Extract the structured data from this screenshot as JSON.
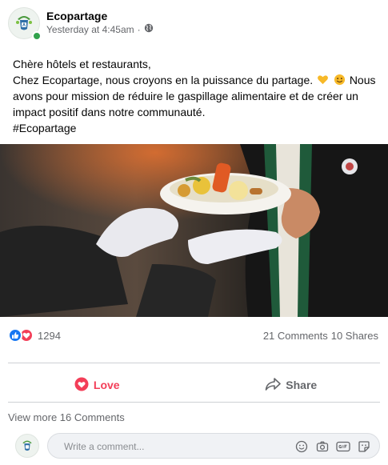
{
  "post": {
    "page_name": "Ecopartage",
    "timestamp": "Yesterday at 4:45am",
    "separator": "·",
    "privacy_icon": "globe-icon",
    "text_lines": {
      "l1": "Chère hôtels et restaurants,",
      "l2": "Chez Ecopartage, nous croyons en la puissance du partage.",
      "l2b": "Nous",
      "l3": "avons pour mission de réduire le gaspillage alimentaire et de créer un",
      "l4": "impact positif dans notre communauté.",
      "l5": "#Ecopartage"
    },
    "emojis": [
      "yellow-heart-emoji",
      "smiling-face-emoji"
    ]
  },
  "stats": {
    "reaction_icons": [
      "like-reaction-icon",
      "love-reaction-icon"
    ],
    "reaction_count": "1294",
    "comments": "21 Comments",
    "shares": "10 Shares"
  },
  "actions": {
    "love_label": "Love",
    "share_label": "Share"
  },
  "comments": {
    "view_more": "View more 16 Comments",
    "placeholder": "Write a comment...",
    "icons": [
      "emoji-icon",
      "camera-icon",
      "gif-icon",
      "sticker-icon"
    ]
  },
  "colors": {
    "love": "#f33e58",
    "like": "#1877f2",
    "online": "#31a24c",
    "muted_text": "#65676b"
  }
}
